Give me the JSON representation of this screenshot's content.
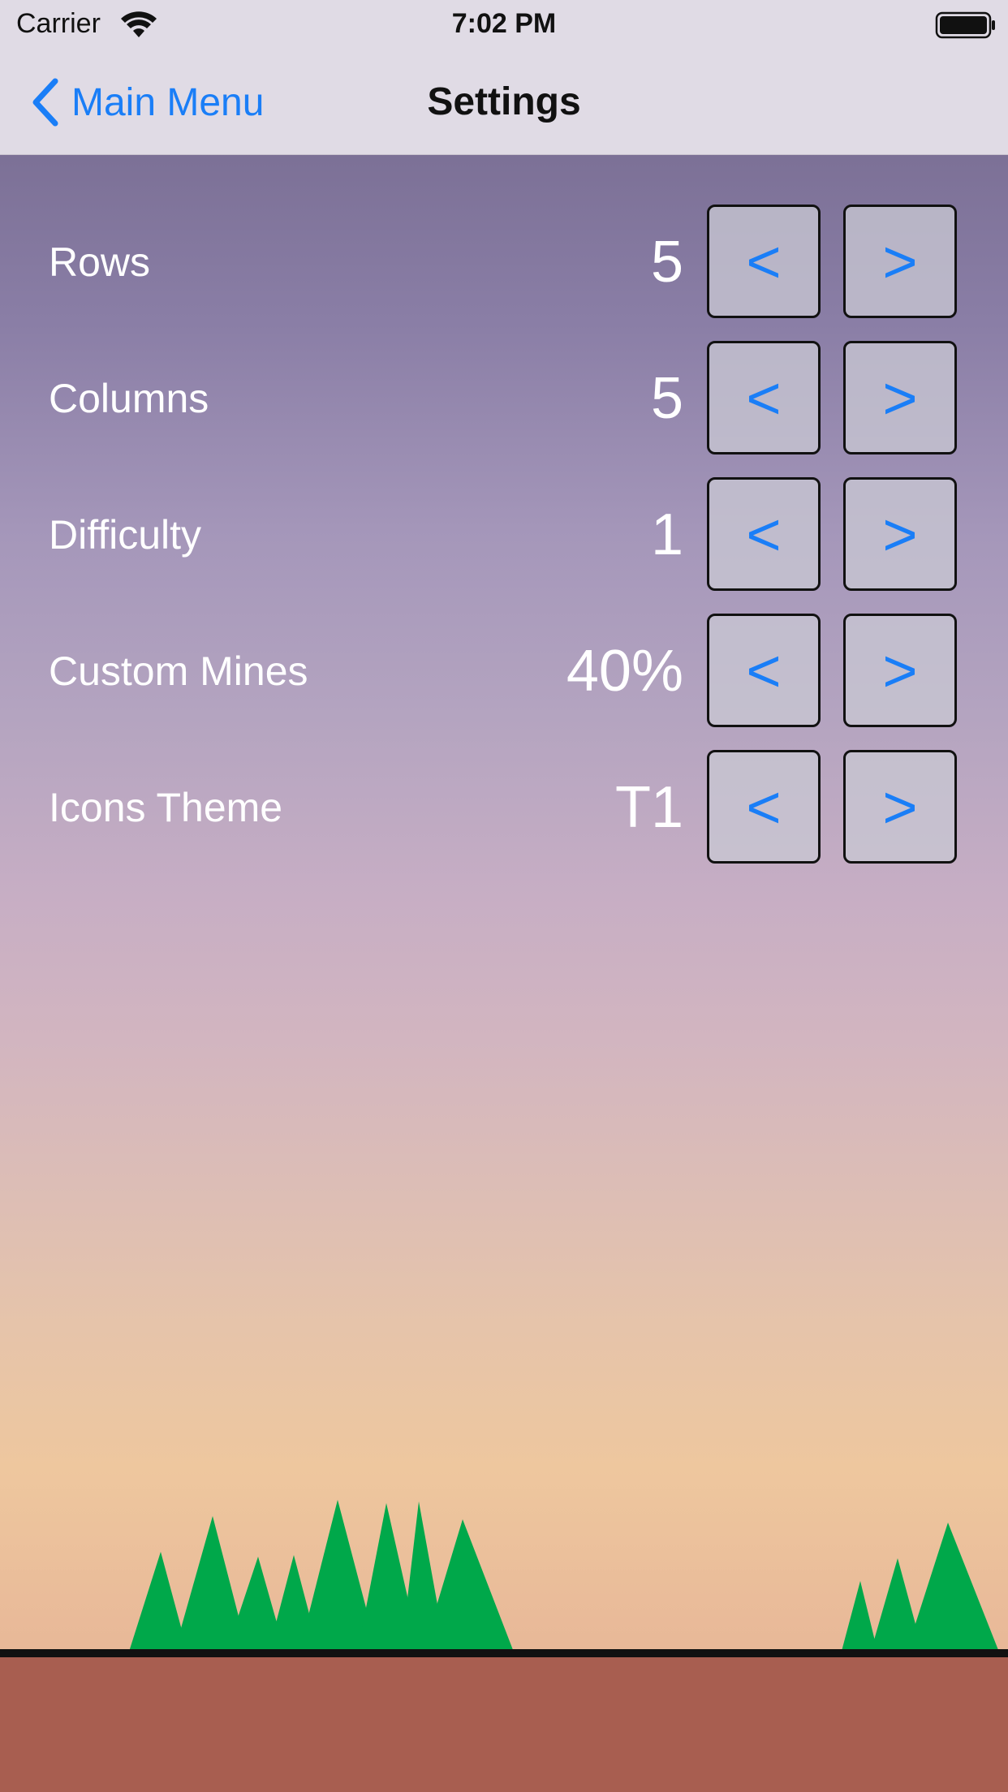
{
  "status_bar": {
    "carrier": "Carrier",
    "time": "7:02 PM",
    "wifi_icon": "wifi-icon",
    "battery_icon": "battery-full-icon"
  },
  "nav": {
    "back_label": "Main Menu",
    "back_icon": "chevron-left-icon",
    "title": "Settings"
  },
  "settings": [
    {
      "label": "Rows",
      "value": "5",
      "prev_label": "<",
      "next_label": ">"
    },
    {
      "label": "Columns",
      "value": "5",
      "prev_label": "<",
      "next_label": ">"
    },
    {
      "label": "Difficulty",
      "value": "1",
      "prev_label": "<",
      "next_label": ">"
    },
    {
      "label": "Custom Mines",
      "value": "40%",
      "prev_label": "<",
      "next_label": ">"
    },
    {
      "label": "Icons Theme",
      "value": "T1",
      "prev_label": "<",
      "next_label": ">"
    }
  ],
  "colors": {
    "accent": "#1a7ef7",
    "ground": "#a85e50",
    "trees": "#00a84a",
    "nav_background": "#e0dbe5"
  }
}
